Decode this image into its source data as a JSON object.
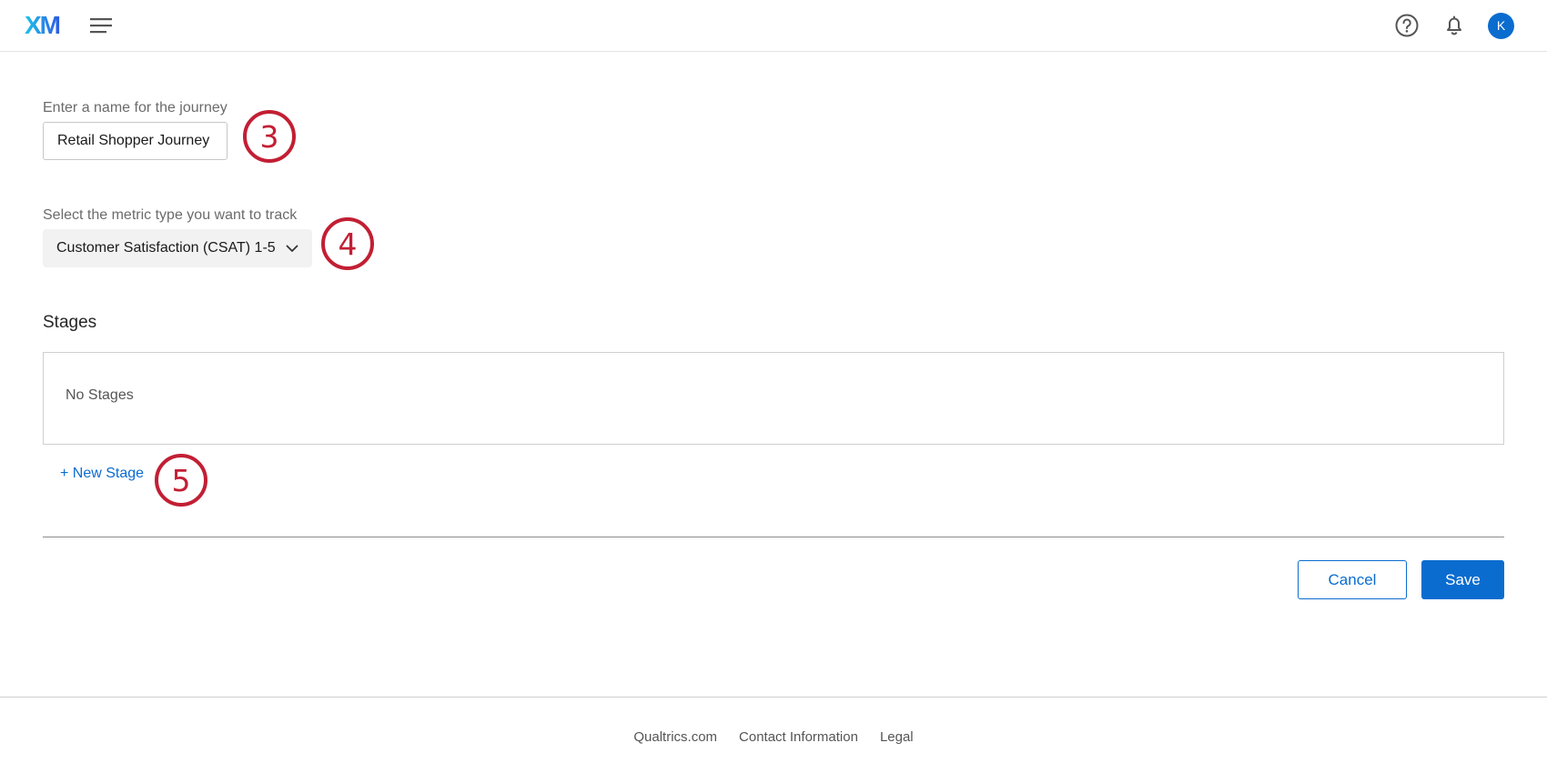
{
  "header": {
    "logo_text": "XM",
    "menu_icon": "hamburger-icon",
    "help_icon": "help-circle-icon",
    "notifications_icon": "bell-icon",
    "avatar_initial": "K"
  },
  "form": {
    "name": {
      "label": "Enter a name for the journey",
      "value": "Retail Shopper Journey"
    },
    "metric": {
      "label": "Select the metric type you want to track",
      "selected": "Customer Satisfaction (CSAT) 1-5"
    },
    "stages": {
      "title": "Stages",
      "empty_text": "No Stages",
      "new_stage_label": "+ New Stage"
    }
  },
  "callouts": [
    "3",
    "4",
    "5"
  ],
  "actions": {
    "cancel_label": "Cancel",
    "save_label": "Save"
  },
  "footer": {
    "links": [
      "Qualtrics.com",
      "Contact Information",
      "Legal"
    ]
  },
  "colors": {
    "primary": "#0b6ccf",
    "callout": "#c21f34",
    "logo_gradient": [
      "#21c4e9",
      "#2d5be3"
    ]
  }
}
